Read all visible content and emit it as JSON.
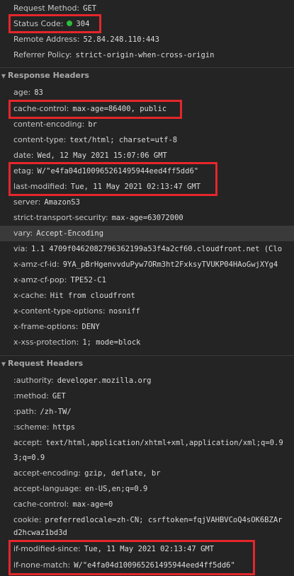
{
  "general": [
    {
      "name": "Request Method:",
      "value": "GET"
    },
    {
      "name": "Status Code:",
      "value": "304"
    },
    {
      "name": "Remote Address:",
      "value": "52.84.248.110:443"
    },
    {
      "name": "Referrer Policy:",
      "value": "strict-origin-when-cross-origin"
    }
  ],
  "status_dot_color": "#2cbd3a",
  "response_headers": {
    "title": "Response Headers",
    "items": [
      {
        "name": "age:",
        "value": "83"
      },
      {
        "name": "cache-control:",
        "value": "max-age=86400, public"
      },
      {
        "name": "content-encoding:",
        "value": "br"
      },
      {
        "name": "content-type:",
        "value": "text/html; charset=utf-8"
      },
      {
        "name": "date:",
        "value": "Wed, 12 May 2021 15:07:06 GMT"
      },
      {
        "name": "etag:",
        "value": "W/\"e4fa04d100965261495944eed4ff5dd6\""
      },
      {
        "name": "last-modified:",
        "value": "Tue, 11 May 2021 02:13:47 GMT"
      },
      {
        "name": "server:",
        "value": "AmazonS3"
      },
      {
        "name": "strict-transport-security:",
        "value": "max-age=63072000"
      },
      {
        "name": "vary:",
        "value": "Accept-Encoding"
      },
      {
        "name": "via:",
        "value": "1.1 4709f0462082796362199a53f4a2cf60.cloudfront.net (Clo"
      },
      {
        "name": "x-amz-cf-id:",
        "value": "9YA_pBrHgenvvduPyw7ORm3ht2FxksyTVUKP04HAoGwjXYg4"
      },
      {
        "name": "x-amz-cf-pop:",
        "value": "TPE52-C1"
      },
      {
        "name": "x-cache:",
        "value": "Hit from cloudfront"
      },
      {
        "name": "x-content-type-options:",
        "value": "nosniff"
      },
      {
        "name": "x-frame-options:",
        "value": "DENY"
      },
      {
        "name": "x-xss-protection:",
        "value": "1; mode=block"
      }
    ]
  },
  "request_headers": {
    "title": "Request Headers",
    "items": [
      {
        "name": ":authority:",
        "value": "developer.mozilla.org"
      },
      {
        "name": ":method:",
        "value": "GET"
      },
      {
        "name": ":path:",
        "value": "/zh-TW/"
      },
      {
        "name": ":scheme:",
        "value": "https"
      },
      {
        "name": "accept:",
        "value": "text/html,application/xhtml+xml,application/xml;q=0.9"
      },
      {
        "name": "",
        "value": "3;q=0.9"
      },
      {
        "name": "accept-encoding:",
        "value": "gzip, deflate, br"
      },
      {
        "name": "accept-language:",
        "value": "en-US,en;q=0.9"
      },
      {
        "name": "cache-control:",
        "value": "max-age=0"
      },
      {
        "name": "cookie:",
        "value": "preferredlocale=zh-CN; csrftoken=fqjVAHBVCoQ4sOK6BZAr"
      },
      {
        "name": "",
        "value": "d2hcwaz1bd3d"
      },
      {
        "name": "if-modified-since:",
        "value": "Tue, 11 May 2021 02:13:47 GMT"
      },
      {
        "name": "if-none-match:",
        "value": "W/\"e4fa04d100965261495944eed4ff5dd6\""
      }
    ]
  },
  "highlight_color": "#e5262b"
}
